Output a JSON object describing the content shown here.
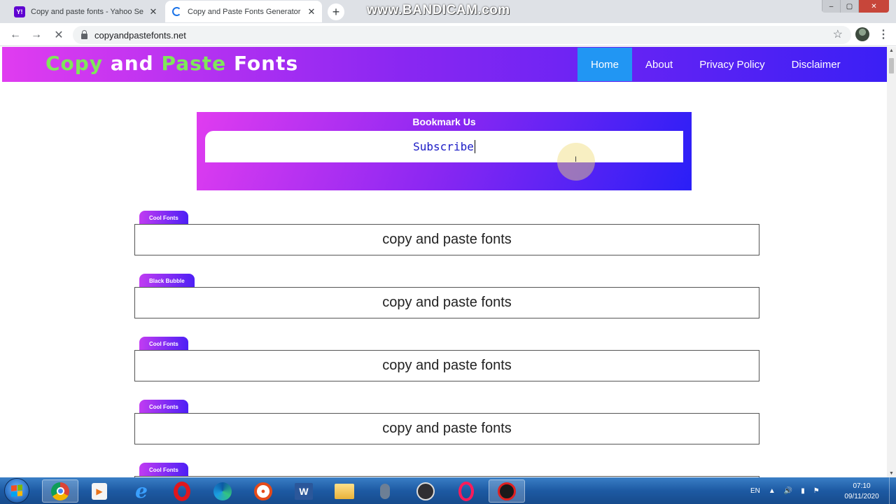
{
  "browser": {
    "tabs": [
      {
        "title": "Copy and paste fonts - Yahoo Se",
        "favicon": "yahoo-icon",
        "active": false
      },
      {
        "title": "Copy and Paste Fonts Generator",
        "favicon": "loading-spinner-icon",
        "active": true
      }
    ],
    "new_tab": "+",
    "watermark": "www.BANDICAM.com",
    "window_controls": {
      "minimize": "–",
      "maximize": "▢",
      "close": "✕"
    },
    "url": "copyandpastefonts.net",
    "bookmark_star": "☆",
    "menu": "⋮"
  },
  "site": {
    "logo": {
      "word1": "Copy",
      "word2": "and",
      "word3": "Paste",
      "word4": "Fonts"
    },
    "nav": [
      {
        "label": "Home",
        "active": true
      },
      {
        "label": "About",
        "active": false
      },
      {
        "label": "Privacy Policy",
        "active": false
      },
      {
        "label": "Disclaimer",
        "active": false
      }
    ]
  },
  "bookmark": {
    "title": "Bookmark Us",
    "input_value": "Subscribe"
  },
  "font_items": [
    {
      "tag": "Cool Fonts",
      "text": "copy and paste fonts"
    },
    {
      "tag": "Black Bubble",
      "text": "copy and paste fonts"
    },
    {
      "tag": "Cool Fonts",
      "text": "copy and paste fonts"
    },
    {
      "tag": "Cool Fonts",
      "text": "copy and paste fonts"
    },
    {
      "tag": "Cool Fonts",
      "text": ""
    }
  ],
  "taskbar": {
    "apps": [
      "chrome-icon",
      "media-player-icon",
      "internet-explorer-icon",
      "opera-icon",
      "edge-icon",
      "vpn-icon",
      "word-icon",
      "file-explorer-icon",
      "mouse-icon",
      "obs-icon",
      "opera-gx-icon",
      "bandicam-icon"
    ],
    "language": "EN",
    "time": "07:10",
    "date": "09/11/2020"
  },
  "colors": {
    "header_gradient": [
      "#e03cf0",
      "#8a27f2",
      "#3b1ff5"
    ],
    "logo_green": "#7fe85a",
    "nav_active": "#2196f3",
    "input_text": "#1b1bc6"
  }
}
